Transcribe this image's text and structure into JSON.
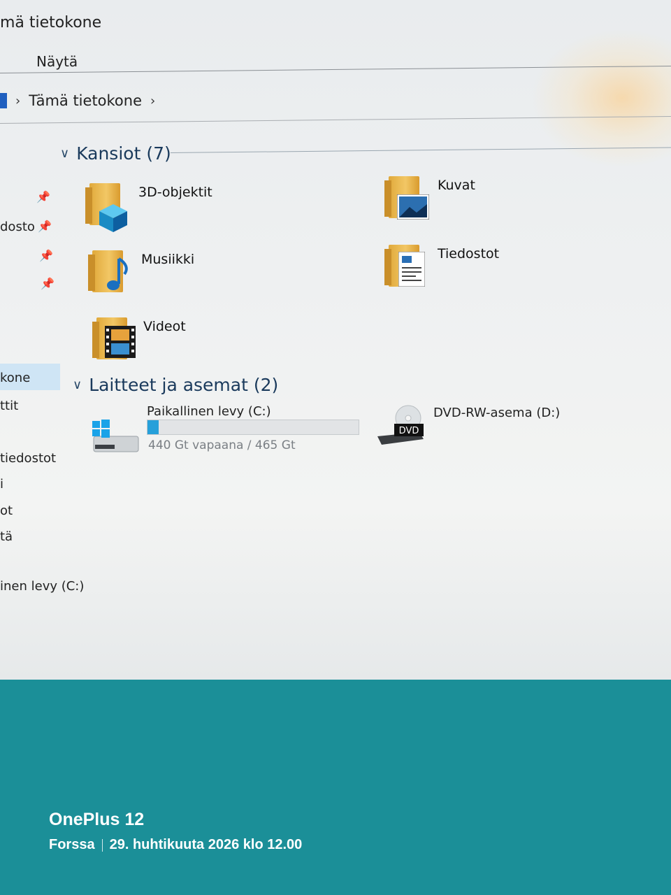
{
  "window": {
    "title": "mä tietokone",
    "ribbon_tab": "Näytä"
  },
  "address": {
    "crumb": "Tämä tietokone"
  },
  "nav": {
    "items": [
      "dosto",
      "kone",
      "ttit",
      "tiedostot",
      "i",
      "ot",
      "tä",
      "inen levy (C:)"
    ]
  },
  "folders": {
    "heading": "Kansiot (7)",
    "items": [
      "3D-objektit",
      "Kuvat",
      "Musiikki",
      "Tiedostot",
      "Videot"
    ]
  },
  "devices": {
    "heading": "Laitteet ja asemat (2)",
    "c_drive": {
      "name": "Paikallinen levy (C:)",
      "free_text": "440 Gt vapaana / 465 Gt",
      "used_fraction": 0.054
    },
    "d_drive": {
      "name": "DVD-RW-asema (D:)",
      "badge": "DVD"
    }
  },
  "watermark": {
    "model": "OnePlus 12",
    "location": "Forssa",
    "datetime": "29. huhtikuuta 2026 klo 12.00"
  },
  "colors": {
    "accent": "#26a0da",
    "desktop": "#1b8f98",
    "selection": "#cfe5f5"
  }
}
